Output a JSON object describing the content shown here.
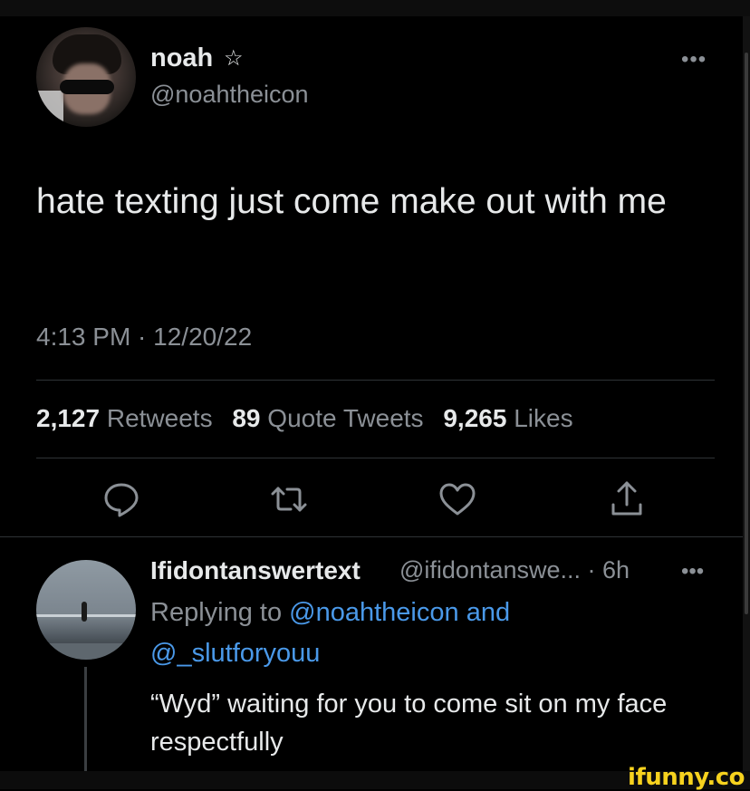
{
  "tweet": {
    "author_name": "noah",
    "author_badge": "☆",
    "author_handle": "@noahtheicon",
    "text": "hate texting just come make out with me",
    "timestamp": "4:13 PM · 12/20/22",
    "more_icon": "more-dots-icon",
    "stats": {
      "retweets_count": "2,127",
      "retweets_label": "Retweets",
      "quotes_count": "89",
      "quotes_label": "Quote Tweets",
      "likes_count": "9,265",
      "likes_label": "Likes"
    },
    "actions": [
      "reply-icon",
      "retweet-icon",
      "like-icon",
      "share-icon"
    ]
  },
  "reply": {
    "author_name": "Ifidontanswertext",
    "meta": "@ifidontanswe... · 6h",
    "replying_prefix": "Replying to",
    "replying_user1": "@noahtheicon",
    "replying_and": "and",
    "replying_user2": "@_slutforyouu",
    "text": "“Wyd” waiting for you to come sit on my face respectfully"
  },
  "watermark": "ifunny.co",
  "colors": {
    "background": "#000000",
    "text": "#e7e9ea",
    "muted": "#8b9096",
    "link": "#4a99e9",
    "watermark": "#f7d21e"
  }
}
